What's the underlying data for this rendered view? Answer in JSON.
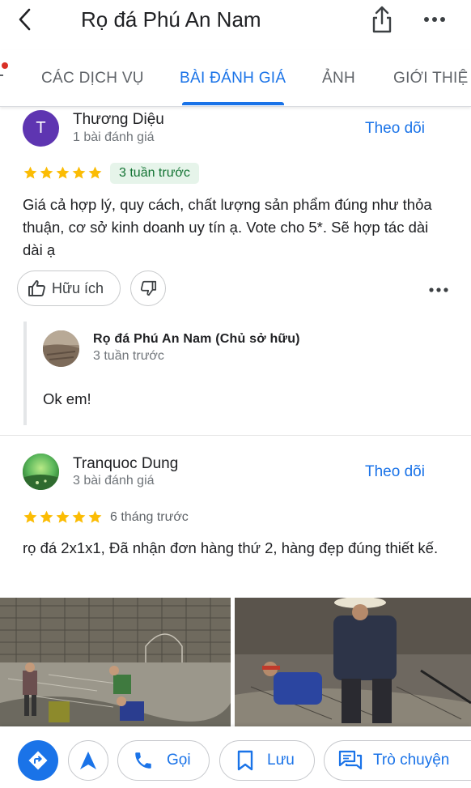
{
  "header": {
    "title": "Rọ đá Phú An Nam"
  },
  "tabs": [
    {
      "label": "CÁC DỊCH VỤ"
    },
    {
      "label": "BÀI ĐÁNH GIÁ"
    },
    {
      "label": "ẢNH"
    },
    {
      "label": "GIỚI THIỆ"
    }
  ],
  "reviews": [
    {
      "avatar_letter": "T",
      "avatar_color": "#5e35b1",
      "name": "Thương Diệu",
      "meta": "1 bài đánh giá",
      "follow": "Theo dõi",
      "rating": 5,
      "time": "3 tuần trước",
      "text": "Giá cả hợp lý, quy cách, chất lượng sản phẩm đúng như thỏa thuận, cơ sở kinh doanh uy tín ạ. Vote cho 5*. Sẽ hợp tác dài dài ạ",
      "helpful_label": "Hữu ích",
      "owner_reply": {
        "name": "Rọ đá Phú An Nam (Chủ sở hữu)",
        "time": "3 tuần trước",
        "text": "Ok em!"
      }
    },
    {
      "name": "Tranquoc Dung",
      "meta": "3 bài đánh giá",
      "follow": "Theo dõi",
      "rating": 5,
      "time": "6 tháng trước",
      "text": "rọ đá 2x1x1, Đã nhận đơn hàng thứ 2, hàng đẹp đúng thiết kế."
    }
  ],
  "actions": {
    "call": "Gọi",
    "save": "Lưu",
    "chat": "Trò chuyện"
  },
  "colors": {
    "accent": "#1a73e8",
    "star": "#fbbc04",
    "badge_bg": "#e6f4ea",
    "badge_text": "#137333"
  }
}
